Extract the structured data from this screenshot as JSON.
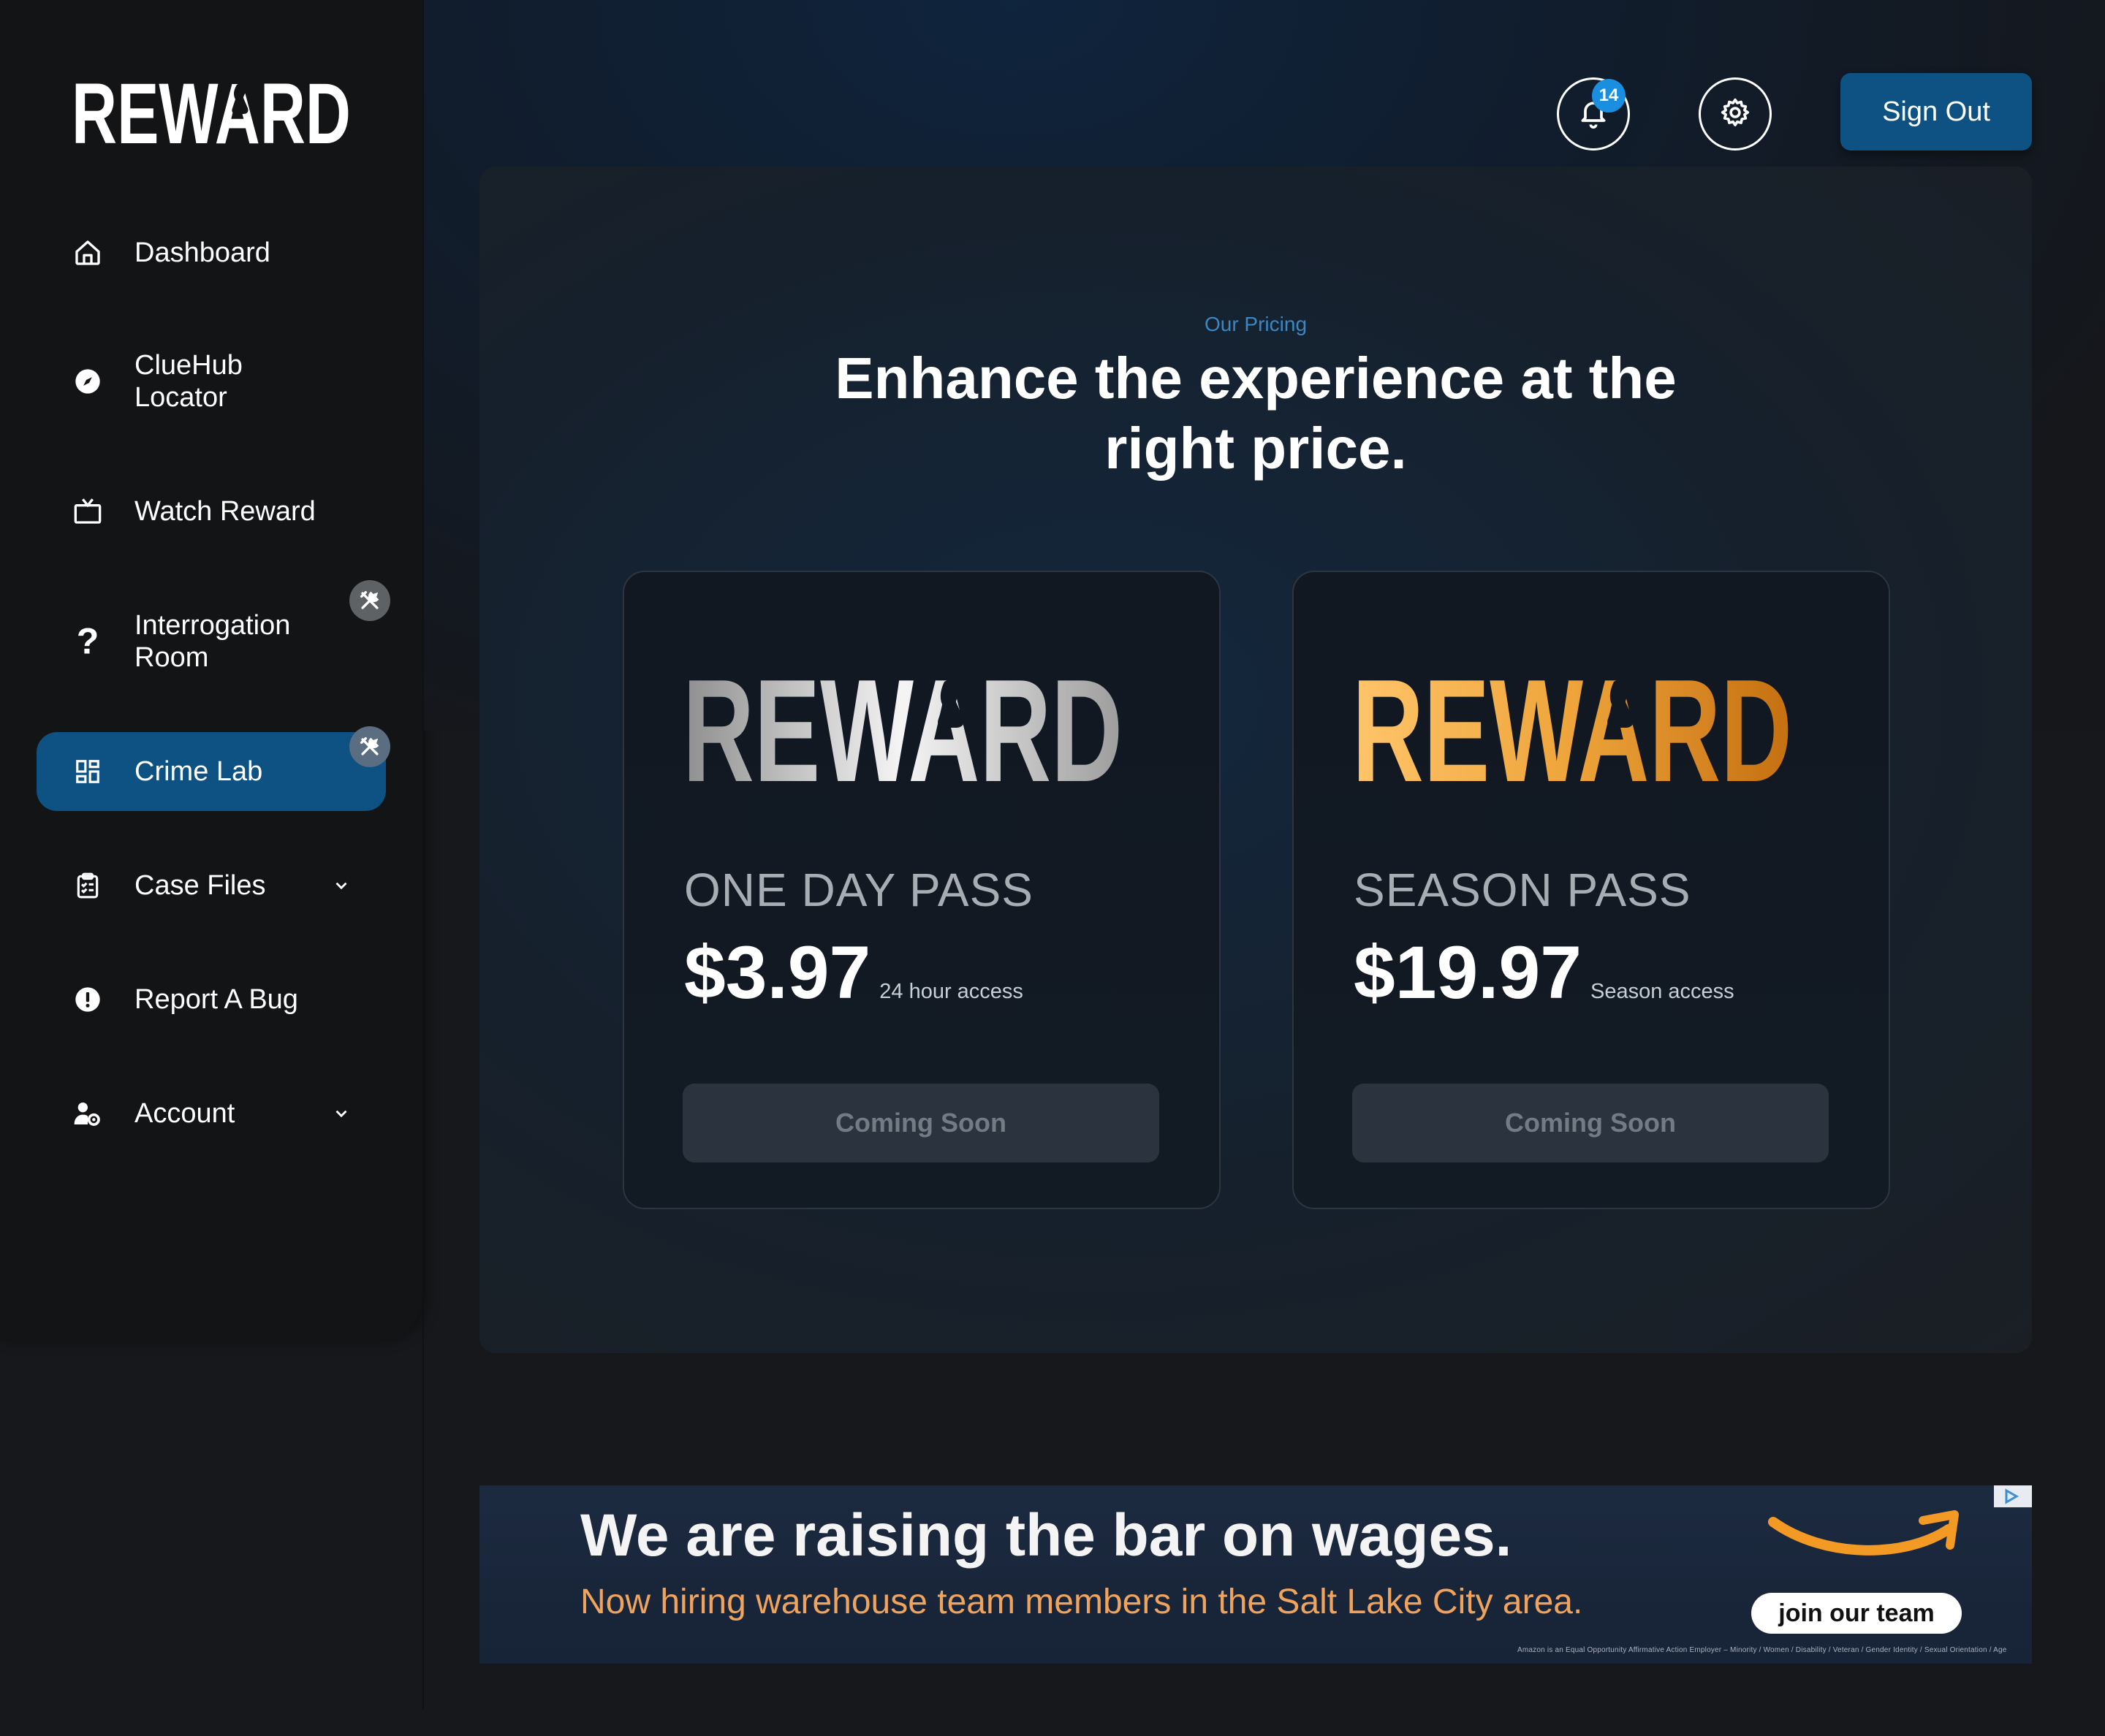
{
  "brand": {
    "logo_text": "REWARD"
  },
  "sidebar": {
    "items": [
      {
        "label": "Dashboard",
        "icon": "home-icon"
      },
      {
        "label": "ClueHub Locator",
        "icon": "compass-icon"
      },
      {
        "label": "Watch Reward",
        "icon": "tv-icon"
      },
      {
        "label": "Interrogation Room",
        "icon": "question-icon",
        "badge": "tools-icon"
      },
      {
        "label": "Crime Lab",
        "icon": "dashboard-grid-icon",
        "badge": "tools-icon",
        "active": true
      },
      {
        "label": "Case Files",
        "icon": "clipboard-icon",
        "expandable": true
      },
      {
        "label": "Report A Bug",
        "icon": "alert-icon"
      },
      {
        "label": "Account",
        "icon": "user-gear-icon",
        "expandable": true
      }
    ]
  },
  "header": {
    "notification_count": "14",
    "sign_out_label": "Sign Out"
  },
  "pricing": {
    "eyebrow": "Our Pricing",
    "headline_line1": "Enhance the experience at the",
    "headline_line2": "right price.",
    "plans": [
      {
        "brand": "REWARD",
        "name": "ONE DAY PASS",
        "price": "$3.97",
        "access": "24 hour access",
        "cta": "Coming Soon",
        "style": "silver"
      },
      {
        "brand": "REWARD",
        "name": "SEASON PASS",
        "price": "$19.97",
        "access": "Season access",
        "cta": "Coming Soon",
        "style": "gold"
      }
    ]
  },
  "ad": {
    "headline": "We are raising the bar on wages.",
    "subline": "Now hiring warehouse team members in the Salt Lake City area.",
    "button": "join our team",
    "fine_print": "Amazon is an Equal Opportunity Affirmative Action Employer – Minority / Women / Disability / Veteran / Gender Identity / Sexual Orientation / Age"
  },
  "colors": {
    "accent": "#0d5283",
    "badge_blue": "#1a8fdf",
    "eyebrow": "#3b87c4",
    "gold": "#f0a63a",
    "silver": "#d6d6d6",
    "ad_orange": "#f0a35c"
  }
}
